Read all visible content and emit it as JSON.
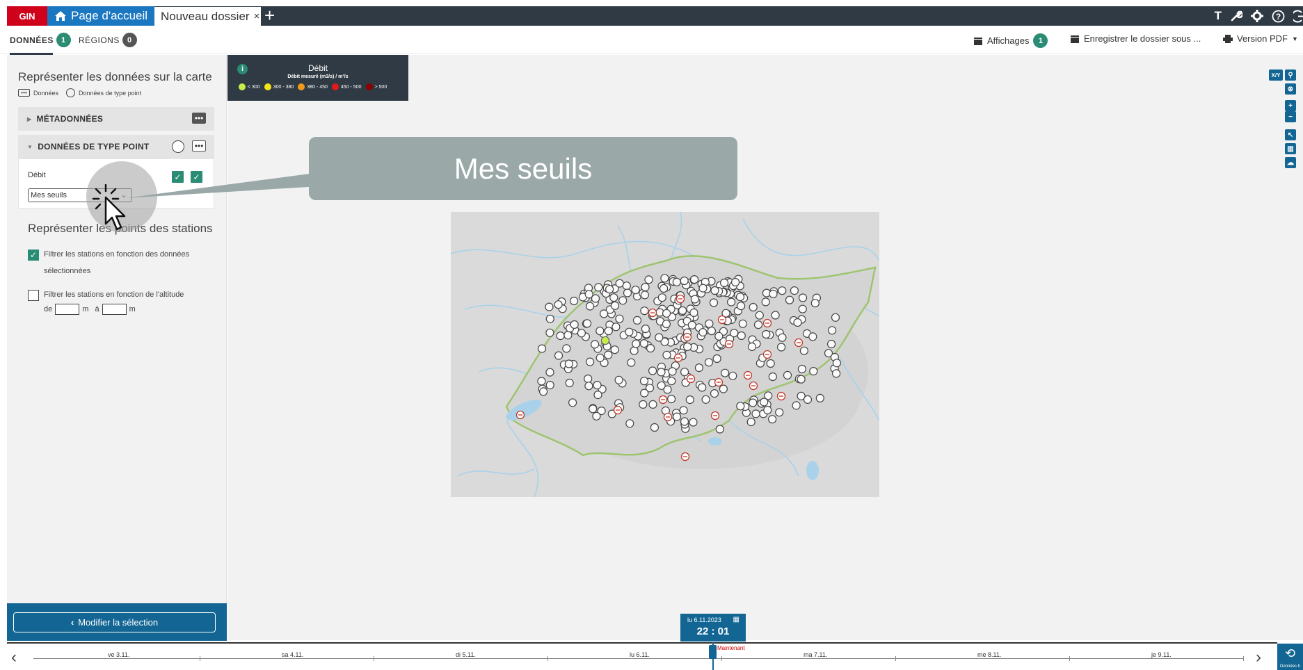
{
  "topbar": {
    "logo": "GIN",
    "home_tab": "Page d'accueil",
    "dossier_tab": "Nouveau dossier",
    "close_glyph": "×",
    "add_glyph": "+",
    "icons": [
      "text-icon",
      "wrench-icon",
      "gear-icon",
      "help-icon",
      "logout-icon"
    ]
  },
  "subbar": {
    "tab_donnees": "DONNÉES",
    "tab_donnees_count": "1",
    "tab_regions": "RÉGIONS",
    "tab_regions_count": "0",
    "affichages": "Affichages",
    "affichages_count": "1",
    "save": "Enregistrer le dossier sous ...",
    "pdf": "Version PDF"
  },
  "left_panel": {
    "title": "Représenter les données sur la carte",
    "legend_donnees": "Données",
    "legend_point": "Données de type point",
    "metadata_header": "MÉTADONNÉES",
    "point_header": "DONNÉES DE TYPE POINT",
    "debit_label": "Débit",
    "select_value": "Mes seuils",
    "stations_title": "Représenter les points des stations",
    "filter_data_text_1": "Filtrer les stations en fonction des données",
    "filter_data_text_2": "sélectionnées",
    "filter_data_checked": true,
    "filter_alt_text": "Filtrer les stations en fonction de l'altitude",
    "alt_de": "de",
    "alt_m1": "m",
    "alt_a": "à",
    "alt_m2": "m",
    "modify_button": "Modifier la sélection"
  },
  "legend": {
    "info": "i",
    "title": "Débit",
    "subtitle": "Débit mesuré (m3/s) / m³/s",
    "classes": [
      {
        "label": "< 300",
        "color": "#c6ec4b"
      },
      {
        "label": "300 - 380",
        "color": "#f3e51a"
      },
      {
        "label": "380 - 450",
        "color": "#f29a1a"
      },
      {
        "label": "450 - 500",
        "color": "#e31a1a"
      },
      {
        "label": "> 500",
        "color": "#8b0000"
      }
    ]
  },
  "callout": {
    "text": "Mes seuils"
  },
  "map_tools": [
    "XY",
    "search-icon",
    "crosshair-icon",
    "zoom-in-icon",
    "zoom-out-icon",
    "pointer-icon",
    "map-icon",
    "cloud-icon"
  ],
  "time": {
    "date": "lu 6.11.2023",
    "clock": "22 : 01",
    "now_label": "Maintenant"
  },
  "timeline": {
    "labels": [
      "ve 3.11.",
      "sa 4.11.",
      "di 5.11.",
      "lu 6.11.",
      "ma 7.11.",
      "me 8.11.",
      "je 9.11."
    ]
  },
  "history": {
    "label": "Données h"
  },
  "colors": {
    "topbar": "#2f3a44",
    "gin_red": "#d0021b",
    "home_blue": "#1b77c0",
    "accent_green": "#2a8c74",
    "panel_blue": "#136694"
  }
}
